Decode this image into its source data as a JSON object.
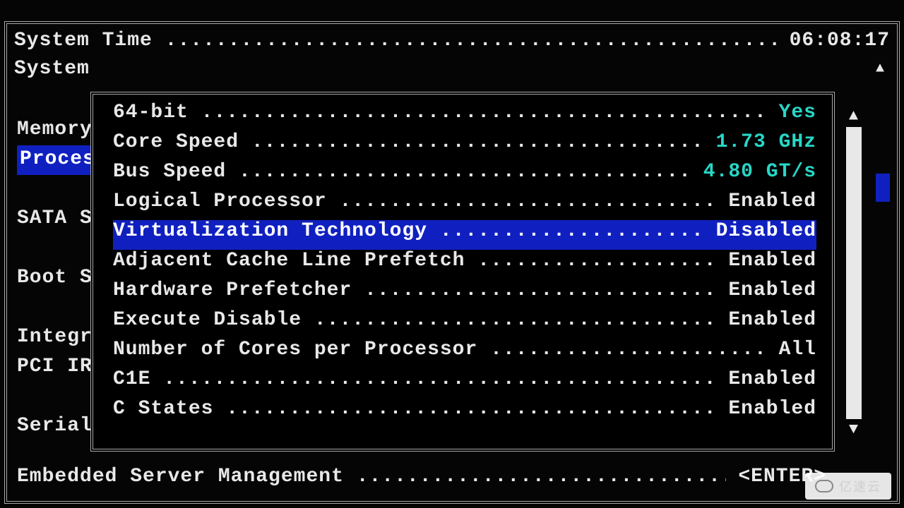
{
  "header": {
    "system_time_label": "System Time",
    "system_time_value": "06:08:17",
    "system_label": "System"
  },
  "left_menu": {
    "items": [
      {
        "label": "Memory"
      },
      {
        "label": "Proces",
        "selected": true
      },
      {
        "label": ""
      },
      {
        "label": "SATA S"
      },
      {
        "label": ""
      },
      {
        "label": "Boot S"
      },
      {
        "label": ""
      },
      {
        "label": "Integr"
      },
      {
        "label": "PCI IR"
      },
      {
        "label": ""
      },
      {
        "label": "Serial"
      }
    ]
  },
  "panel": {
    "rows": [
      {
        "label": "64-bit",
        "value": "Yes",
        "value_class": "cyan"
      },
      {
        "label": "Core Speed",
        "value": "1.73 GHz",
        "value_class": "cyan"
      },
      {
        "label": "Bus Speed",
        "value": "4.80 GT/s",
        "value_class": "cyan"
      },
      {
        "label": "Logical Processor",
        "value": "Enabled"
      },
      {
        "label": "Virtualization Technology",
        "value": "Disabled",
        "selected": true
      },
      {
        "label": "Adjacent Cache Line Prefetch",
        "value": "Enabled"
      },
      {
        "label": "Hardware Prefetcher",
        "value": "Enabled"
      },
      {
        "label": "Execute Disable",
        "value": "Enabled"
      },
      {
        "label": "Number of Cores per Processor",
        "value": "All"
      },
      {
        "label": "C1E",
        "value": "Enabled"
      },
      {
        "label": "C States",
        "value": "Enabled"
      }
    ]
  },
  "footer": {
    "label": "Embedded Server Management",
    "value": "<ENTER>"
  },
  "watermark": {
    "text": "亿速云"
  },
  "dots": "................................................................................................................"
}
